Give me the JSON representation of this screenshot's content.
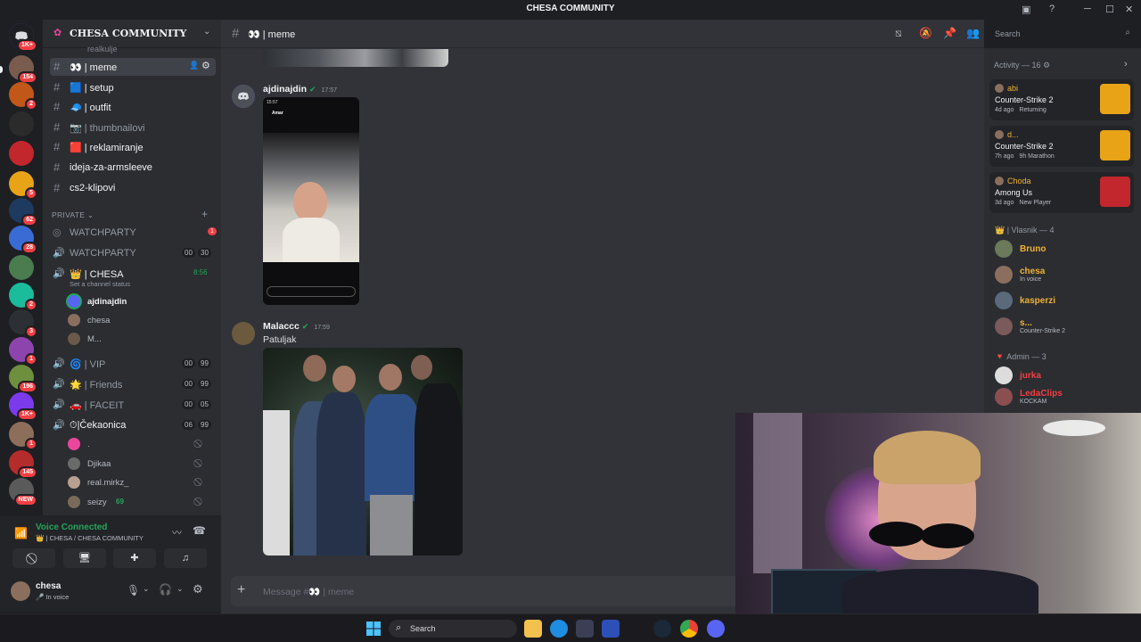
{
  "window": {
    "title": "CHESA COMMUNITY"
  },
  "server": {
    "name": "CHESA COMMUNITY"
  },
  "servers": [
    {
      "badge": "1K+",
      "color": "#5865f2",
      "icon": "discord-home-icon"
    },
    {
      "badge": "154",
      "color": "#7a5c4f"
    },
    {
      "badge": "2",
      "color": "#c2571a"
    },
    {
      "badge": "",
      "color": "#2b2b2b"
    },
    {
      "badge": "",
      "color": "#c1272d"
    },
    {
      "badge": "5",
      "color": "#e8a317"
    },
    {
      "badge": "62",
      "color": "#1e3a5f"
    },
    {
      "badge": "28",
      "color": "#3a6bd4"
    },
    {
      "badge": "",
      "color": "#4a7c4f"
    },
    {
      "badge": "2",
      "color": "#1abc9c"
    },
    {
      "badge": "3",
      "color": "#2c2f33"
    },
    {
      "badge": "1",
      "color": "#8e44ad"
    },
    {
      "badge": "196",
      "color": "#6d8f3e"
    },
    {
      "badge": "1K+",
      "color": "#7c3aed"
    },
    {
      "badge": "1",
      "color": "#8c6e5a"
    },
    {
      "badge": "145",
      "color": "#b52c2c"
    },
    {
      "badge": "NEW",
      "color": "#5a5a5a"
    }
  ],
  "channels": {
    "top_partial": "realkulje",
    "text": [
      {
        "label": "👀 | meme",
        "active": true
      },
      {
        "label": "🟦 | setup"
      },
      {
        "label": "🧢 | outfit"
      },
      {
        "label": "📷 | thumbnailovi",
        "muted": true
      },
      {
        "label": "🟥 | reklamiranje"
      },
      {
        "label": "ideja-za-armsleeve"
      },
      {
        "label": "cs2-klipovi"
      }
    ],
    "private_label": "PRIVATE",
    "voice": [
      {
        "label": "WATCHPARTY",
        "badge": "1",
        "icon": "stage-icon"
      },
      {
        "label": "WATCHPARTY",
        "c1": "00",
        "c2": "30"
      },
      {
        "label": "👑 | CHESA",
        "time": "8:56",
        "status": "Set a channel status",
        "live": true
      }
    ],
    "chesa_users": [
      "ajdinajdin",
      "chesa",
      "M..."
    ],
    "voice2": [
      {
        "label": "🌀 | VIP",
        "c1": "00",
        "c2": "99"
      },
      {
        "label": "🌟 | Friends",
        "c1": "00",
        "c2": "99"
      },
      {
        "label": "🚗 | FACEIT",
        "c1": "00",
        "c2": "05"
      },
      {
        "label": "⏱|Čekaonica",
        "c1": "06",
        "c2": "99",
        "live": true
      }
    ],
    "wait_users": [
      ".",
      "Djikaa",
      "real.mirkz_",
      "seizy"
    ],
    "seizy_extra": "69"
  },
  "voice_panel": {
    "status": "Voice Connected",
    "location": "👑 | CHESA / CHESA COMMUNITY"
  },
  "user_panel": {
    "name": "chesa",
    "status": "In voice"
  },
  "chat": {
    "channel": "👀 | meme",
    "messages": [
      {
        "author": "ajdinajdin",
        "time": "17:57",
        "story_user": "Amar",
        "story_time": "15:57"
      },
      {
        "author": "Malaccc",
        "time": "17:59",
        "text": "Patuljak"
      }
    ],
    "composer_placeholder": "Message #👀 | meme"
  },
  "search": {
    "placeholder": "Search"
  },
  "members": {
    "activity_header": "Activity — 16",
    "activities": [
      {
        "name": "abi",
        "game": "Counter-Strike 2",
        "meta": "4d ago",
        "meta2": "Returning"
      },
      {
        "name": "d...",
        "game": "Counter-Strike 2",
        "meta": "7h ago",
        "meta2": "9h Marathon"
      },
      {
        "name": "Choda",
        "game": "Among Us",
        "meta": "3d ago",
        "meta2": "New Player"
      }
    ],
    "group1": "👑 | Vlasnik — 4",
    "vlasnik": [
      {
        "name": "Bruno",
        "status": ""
      },
      {
        "name": "chesa",
        "status": "In voice"
      },
      {
        "name": "kasperzi",
        "status": ""
      },
      {
        "name": "s...",
        "status": "Counter-Strike 2"
      }
    ],
    "group2": "Admin — 3",
    "admin": [
      {
        "name": "jurka",
        "status": ""
      },
      {
        "name": "LedaClips",
        "status": "KOCKAM"
      }
    ]
  },
  "taskbar": {
    "search": "Search"
  },
  "colors": {
    "accent": "#5865f2",
    "green": "#23a55a",
    "gold": "#f0b232",
    "red": "#f23f43"
  }
}
